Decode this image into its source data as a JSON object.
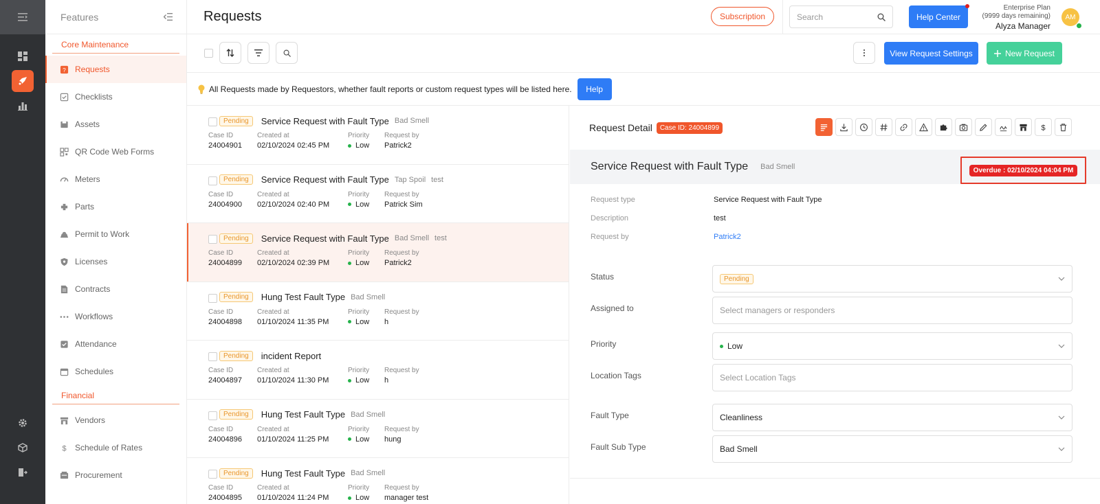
{
  "rail": {
    "icons": [
      "menu-expand-icon",
      "dashboard-icon",
      "rocket-icon",
      "analytics-icon",
      "gear-icon",
      "box-icon",
      "logout-icon"
    ]
  },
  "features": {
    "title": "Features",
    "sections": [
      {
        "label": "Core Maintenance",
        "items": [
          {
            "label": "Requests",
            "icon": "request-icon",
            "active": true
          },
          {
            "label": "Checklists",
            "icon": "checklist-icon"
          },
          {
            "label": "Assets",
            "icon": "asset-icon"
          },
          {
            "label": "QR Code Web Forms",
            "icon": "qr-icon"
          },
          {
            "label": "Meters",
            "icon": "meter-icon"
          },
          {
            "label": "Parts",
            "icon": "parts-icon"
          },
          {
            "label": "Permit to Work",
            "icon": "permit-icon"
          },
          {
            "label": "Licenses",
            "icon": "license-icon"
          },
          {
            "label": "Contracts",
            "icon": "contract-icon"
          },
          {
            "label": "Workflows",
            "icon": "workflow-icon"
          },
          {
            "label": "Attendance",
            "icon": "attendance-icon"
          },
          {
            "label": "Schedules",
            "icon": "calendar-icon"
          }
        ]
      },
      {
        "label": "Financial",
        "items": [
          {
            "label": "Vendors",
            "icon": "vendor-icon"
          },
          {
            "label": "Schedule of Rates",
            "icon": "dollar-icon"
          },
          {
            "label": "Procurement",
            "icon": "procurement-icon"
          }
        ]
      }
    ]
  },
  "header": {
    "title": "Requests",
    "subscription": "Subscription",
    "search_placeholder": "Search",
    "help_center": "Help Center",
    "plan": "Enterprise Plan",
    "plan_days": "(9999 days remaining)",
    "user": "Alyza Manager",
    "avatar_initials": "AM"
  },
  "toolbar": {
    "view_settings": "View Request Settings",
    "new_request": "New Request"
  },
  "info": {
    "text": "All Requests made by Requestors, whether fault reports or custom request types will be listed here.",
    "help": "Help"
  },
  "list": {
    "labels": {
      "case_id": "Case ID",
      "created": "Created at",
      "priority": "Priority",
      "request_by": "Request by"
    },
    "items": [
      {
        "status": "Pending",
        "title": "Service Request with Fault Type",
        "tags": [
          "Bad Smell"
        ],
        "case_id": "24004901",
        "created": "02/10/2024 02:45 PM",
        "priority": "Low",
        "by": "Patrick2"
      },
      {
        "status": "Pending",
        "title": "Service Request with Fault Type",
        "tags": [
          "Tap Spoil",
          "test"
        ],
        "case_id": "24004900",
        "created": "02/10/2024 02:40 PM",
        "priority": "Low",
        "by": "Patrick Sim"
      },
      {
        "status": "Pending",
        "title": "Service Request with Fault Type",
        "tags": [
          "Bad Smell",
          "test"
        ],
        "case_id": "24004899",
        "created": "02/10/2024 02:39 PM",
        "priority": "Low",
        "by": "Patrick2",
        "selected": true
      },
      {
        "status": "Pending",
        "title": "Hung Test Fault Type",
        "tags": [
          "Bad Smell"
        ],
        "case_id": "24004898",
        "created": "01/10/2024 11:35 PM",
        "priority": "Low",
        "by": "h"
      },
      {
        "status": "Pending",
        "title": "incident Report",
        "tags": [],
        "case_id": "24004897",
        "created": "01/10/2024 11:30 PM",
        "priority": "Low",
        "by": "h"
      },
      {
        "status": "Pending",
        "title": "Hung Test Fault Type",
        "tags": [
          "Bad Smell"
        ],
        "case_id": "24004896",
        "created": "01/10/2024 11:25 PM",
        "priority": "Low",
        "by": "hung"
      },
      {
        "status": "Pending",
        "title": "Hung Test Fault Type",
        "tags": [
          "Bad Smell"
        ],
        "case_id": "24004895",
        "created": "01/10/2024 11:24 PM",
        "priority": "Low",
        "by": "manager test"
      }
    ]
  },
  "detail": {
    "title": "Request Detail",
    "case_badge": "Case ID: 24004899",
    "icons": [
      "details-icon",
      "download-icon",
      "clock-icon",
      "hash-icon",
      "link-icon",
      "warning-icon",
      "puzzle-icon",
      "camera-icon",
      "edit-icon",
      "signature-icon",
      "store-icon",
      "dollar-icon",
      "trash-icon"
    ],
    "subject": "Service Request with Fault Type",
    "subject_tag": "Bad Smell",
    "overdue": "Overdue : 02/10/2024 04:04 PM",
    "info": [
      {
        "label": "Request type",
        "value": "Service Request with Fault Type"
      },
      {
        "label": "Description",
        "value": "test"
      },
      {
        "label": "Request by",
        "value": "Patrick2",
        "link": true
      }
    ],
    "fields": {
      "status": {
        "label": "Status",
        "value": "Pending"
      },
      "assigned": {
        "label": "Assigned to",
        "placeholder": "Select managers or responders"
      },
      "priority": {
        "label": "Priority",
        "value": "Low"
      },
      "location": {
        "label": "Location Tags",
        "placeholder": "Select Location Tags"
      },
      "fault_type": {
        "label": "Fault Type",
        "value": "Cleanliness"
      },
      "fault_sub_type": {
        "label": "Fault Sub Type",
        "value": "Bad Smell"
      }
    }
  },
  "colors": {
    "accent": "#f26233",
    "primary": "#2e7cf6",
    "success": "#45d19a",
    "danger": "#e52525"
  }
}
